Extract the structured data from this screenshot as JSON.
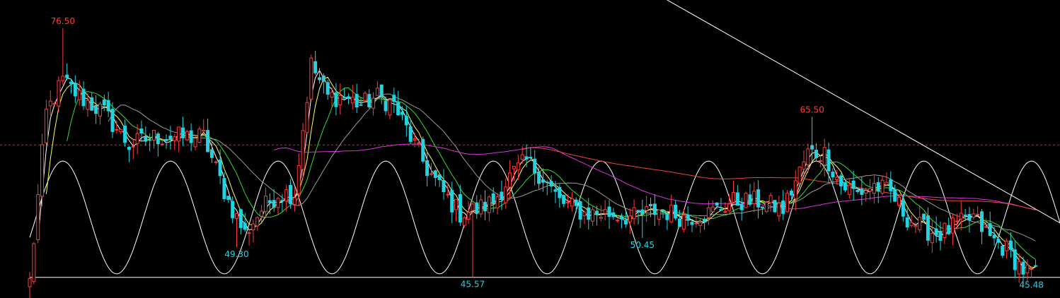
{
  "chart_data": {
    "type": "candlestick",
    "title": "",
    "xlabel": "",
    "ylabel": "",
    "ylim": [
      43,
      80
    ],
    "grid": false,
    "legend": "none",
    "colors": {
      "background": "#000000",
      "up": "#ff3a3a",
      "down": "#22d3e0",
      "label_high": "#ff3a3a",
      "label_low": "#22d3e0",
      "ref_line": "#b03a2e",
      "trendline": "#ffffff",
      "cycle_wave": "#ffffff",
      "baseline": "#ffffff",
      "ma_fast": "#ffffff",
      "ma_yellow": "#ffff55",
      "ma_green": "#33dd33",
      "ma_grey": "#9a9a9a",
      "ma_magenta": "#dd33dd",
      "ma_red": "#ee4444"
    },
    "reference_level": 62.0,
    "baseline_level": 45.57,
    "cycle_period_bars": 26,
    "anchors": [
      {
        "i": 0,
        "c": 45
      },
      {
        "i": 4,
        "c": 66
      },
      {
        "i": 8,
        "c": 70
      },
      {
        "i": 12,
        "c": 68
      },
      {
        "i": 18,
        "c": 66
      },
      {
        "i": 24,
        "c": 62
      },
      {
        "i": 30,
        "c": 63
      },
      {
        "i": 36,
        "c": 63
      },
      {
        "i": 42,
        "c": 63
      },
      {
        "i": 48,
        "c": 55
      },
      {
        "i": 52,
        "c": 51
      },
      {
        "i": 56,
        "c": 54
      },
      {
        "i": 60,
        "c": 56
      },
      {
        "i": 64,
        "c": 56
      },
      {
        "i": 68,
        "c": 72
      },
      {
        "i": 72,
        "c": 68
      },
      {
        "i": 76,
        "c": 68
      },
      {
        "i": 80,
        "c": 67
      },
      {
        "i": 84,
        "c": 68
      },
      {
        "i": 88,
        "c": 67
      },
      {
        "i": 92,
        "c": 63
      },
      {
        "i": 96,
        "c": 59
      },
      {
        "i": 100,
        "c": 56
      },
      {
        "i": 104,
        "c": 53.5
      },
      {
        "i": 108,
        "c": 54
      },
      {
        "i": 112,
        "c": 55
      },
      {
        "i": 116,
        "c": 58
      },
      {
        "i": 120,
        "c": 60
      },
      {
        "i": 124,
        "c": 58
      },
      {
        "i": 128,
        "c": 55
      },
      {
        "i": 134,
        "c": 53.5
      },
      {
        "i": 140,
        "c": 53.5
      },
      {
        "i": 146,
        "c": 53
      },
      {
        "i": 152,
        "c": 54
      },
      {
        "i": 158,
        "c": 53
      },
      {
        "i": 164,
        "c": 53.5
      },
      {
        "i": 170,
        "c": 55
      },
      {
        "i": 176,
        "c": 55
      },
      {
        "i": 182,
        "c": 54
      },
      {
        "i": 188,
        "c": 61
      },
      {
        "i": 192,
        "c": 61
      },
      {
        "i": 196,
        "c": 57
      },
      {
        "i": 200,
        "c": 56
      },
      {
        "i": 204,
        "c": 57
      },
      {
        "i": 208,
        "c": 56
      },
      {
        "i": 212,
        "c": 53
      },
      {
        "i": 216,
        "c": 51.5
      },
      {
        "i": 220,
        "c": 51
      },
      {
        "i": 224,
        "c": 52
      },
      {
        "i": 228,
        "c": 53
      },
      {
        "i": 232,
        "c": 50.5
      },
      {
        "i": 236,
        "c": 49
      },
      {
        "i": 240,
        "c": 46.5
      },
      {
        "i": 243,
        "c": 45.8
      }
    ],
    "extremes": [
      {
        "label": "76.50",
        "i": 8,
        "value": 76.5,
        "kind": "high"
      },
      {
        "label": "49.30",
        "i": 50,
        "value": 49.3,
        "kind": "low"
      },
      {
        "label": "45.57",
        "i": 107,
        "value": 45.57,
        "kind": "low"
      },
      {
        "label": "50.45",
        "i": 148,
        "value": 50.45,
        "kind": "low"
      },
      {
        "label": "65.50",
        "i": 189,
        "value": 65.5,
        "kind": "high"
      },
      {
        "label": "45.48",
        "i": 242,
        "value": 45.48,
        "kind": "low"
      }
    ],
    "trendline": [
      {
        "i": 130,
        "value": 87
      },
      {
        "i": 250,
        "value": 52
      }
    ],
    "moving_averages": [
      {
        "period": 3,
        "color_key": "ma_fast"
      },
      {
        "period": 5,
        "color_key": "ma_yellow"
      },
      {
        "period": 10,
        "color_key": "ma_green"
      },
      {
        "period": 20,
        "color_key": "ma_grey"
      },
      {
        "period": 60,
        "color_key": "ma_magenta"
      },
      {
        "period": 120,
        "color_key": "ma_red"
      }
    ]
  }
}
